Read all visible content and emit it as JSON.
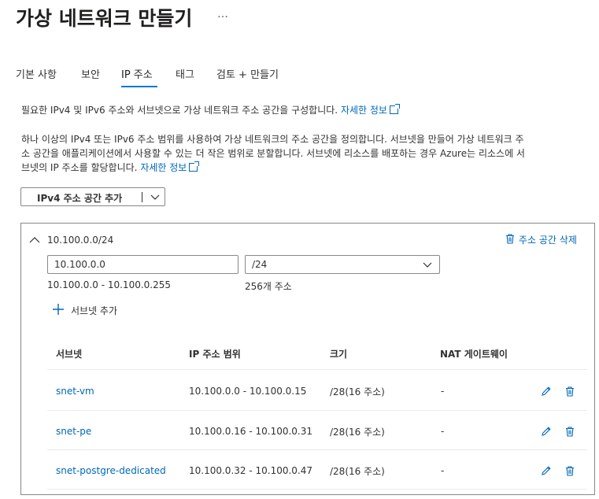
{
  "header": {
    "title": "가상 네트워크 만들기",
    "more": "…"
  },
  "tabs": [
    {
      "label": "기본 사항"
    },
    {
      "label": "보안"
    },
    {
      "label": "IP 주소"
    },
    {
      "label": "태그"
    },
    {
      "label": "검토 + 만들기"
    }
  ],
  "intro": {
    "text": "필요한 IPv4 및 IPv6 주소와 서브넷으로 가상 네트워크 주소 공간을 구성합니다.",
    "link": "자세한 정보"
  },
  "description": {
    "line1": "하나 이상의 IPv4 또는 IPv6 주소 범위를 사용하여 가상 네트워크의 주소 공간을 정의합니다. 서브넷을 만들어 가상 네트워크 주",
    "line2": "소 공간을 애플리케이션에서 사용할 수 있는 더 작은 범위로 분할합니다. 서브넷에 리소스를 배포하는 경우 Azure는 리소스에 서",
    "line3": "브넷의 IP 주소를 할당합니다.",
    "link": "자세한 정보"
  },
  "add_space_button": {
    "label": "IPv4 주소 공간 추가"
  },
  "address_space": {
    "name": "10.100.0.0/24",
    "delete_label": "주소 공간 삭제",
    "address_value": "10.100.0.0",
    "prefix_value": "/24",
    "range_hint": "10.100.0.0 - 10.100.0.255",
    "count_hint": "256개 주소",
    "add_subnet_label": "서브넷 추가"
  },
  "subnet_table": {
    "headers": [
      "서브넷",
      "IP 주소 범위",
      "크기",
      "NAT 게이트웨이"
    ],
    "rows": [
      {
        "name": "snet-vm",
        "range": "10.100.0.0 - 10.100.0.15",
        "size": "/28(16 주소)",
        "nat": "-"
      },
      {
        "name": "snet-pe",
        "range": "10.100.0.16 - 10.100.0.31",
        "size": "/28(16 주소)",
        "nat": "-"
      },
      {
        "name": "snet-postgre-dedicated",
        "range": "10.100.0.32 - 10.100.0.47",
        "size": "/28(16 주소)",
        "nat": "-"
      }
    ]
  },
  "colors": {
    "accent": "#0078d4",
    "link": "#0067b8",
    "text": "#323130",
    "border": "#8a8886"
  }
}
